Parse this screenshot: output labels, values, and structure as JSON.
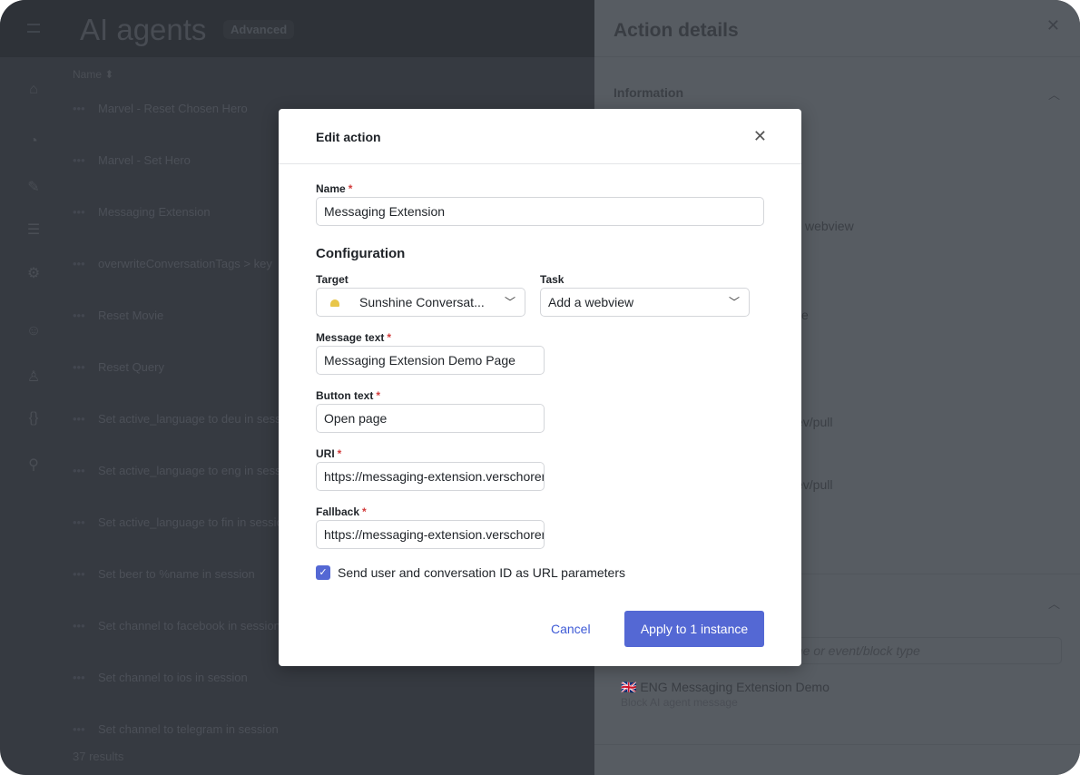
{
  "header": {
    "title": "AI agents",
    "badge": "Advanced"
  },
  "list": {
    "column": "Name ⬍",
    "rows": [
      "Marvel - Reset Chosen Hero",
      "Marvel - Set Hero",
      "Messaging Extension",
      "overwriteConversationTags > key",
      "Reset Movie",
      "Reset Query",
      "Set active_language to deu in session",
      "Set active_language to eng in session",
      "Set active_language to fin in session",
      "Set beer to %name in session",
      "Set channel to facebook in session",
      "Set channel to ios in session",
      "Set channel to telegram in session"
    ],
    "results": "37 results"
  },
  "panel": {
    "title": "Action details",
    "information": "Information",
    "fragments": [
      "webview",
      "e",
      "ev/pull",
      "ev/pull"
    ],
    "search_placeholder": "me or event/block type",
    "item": "🇬🇧 ENG Messaging Extension Demo",
    "item_sub": "Block AI agent message"
  },
  "modal": {
    "title": "Edit action",
    "name_label": "Name",
    "name_value": "Messaging Extension",
    "configuration": "Configuration",
    "target_label": "Target",
    "target_value": "Sunshine Conversat...",
    "task_label": "Task",
    "task_value": "Add a webview",
    "message_label": "Message text",
    "message_value": "Messaging Extension Demo Page",
    "button_label": "Button text",
    "button_value": "Open page",
    "uri_label": "URI",
    "uri_value": "https://messaging-extension.verschoren.dev/pull",
    "fallback_label": "Fallback",
    "fallback_value": "https://messaging-extension.verschoren.dev/pull",
    "checkbox_label": "Send user and conversation ID as URL parameters",
    "checkbox_checked": true,
    "cancel": "Cancel",
    "apply": "Apply to 1 instance",
    "required": "*"
  },
  "colors": {
    "accent": "#5468d4",
    "required": "#d23b3b",
    "target_icon": "#e8c64a"
  }
}
